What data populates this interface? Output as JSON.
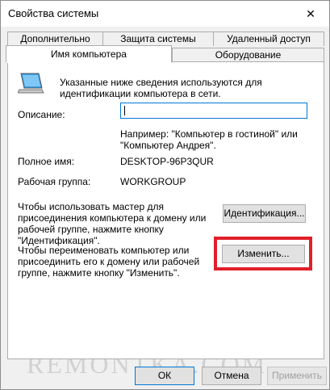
{
  "window": {
    "title": "Свойства системы"
  },
  "tabs": {
    "row1": [
      "Дополнительно",
      "Защита системы",
      "Удаленный доступ"
    ],
    "row2": [
      "Имя компьютера",
      "Оборудование"
    ],
    "active": "Имя компьютера"
  },
  "computer_name": {
    "intro": [
      "Указанные ниже сведения используются для",
      "идентификации компьютера в сети."
    ],
    "description_label": "Описание:",
    "description_value": "",
    "example": [
      "Например: \"Компьютер в гостиной\" или",
      "\"Компьютер Андрея\"."
    ],
    "full_name_label": "Полное имя:",
    "full_name_value": "DESKTOP-96P3QUR",
    "workgroup_label": "Рабочая группа:",
    "workgroup_value": "WORKGROUP",
    "identify_text": [
      "Чтобы использовать мастер для",
      "присоединения компьютера к домену или",
      "рабочей группе, нажмите кнопку",
      "\"Идентификация\"."
    ],
    "identify_button": "Идентификация...",
    "rename_text": [
      "Чтобы переименовать компьютер или",
      "присоединить его к домену или рабочей",
      "группе, нажмите кнопку \"Изменить\"."
    ],
    "change_button": "Изменить..."
  },
  "footer": {
    "ok": "ОК",
    "cancel": "Отмена",
    "apply": "Применить"
  },
  "watermark": "REMONTKA.COM",
  "colors": {
    "highlight": "#e0202a",
    "focus": "#0078d7"
  },
  "icons": {
    "close": "close-icon",
    "computer": "computer-icon"
  }
}
